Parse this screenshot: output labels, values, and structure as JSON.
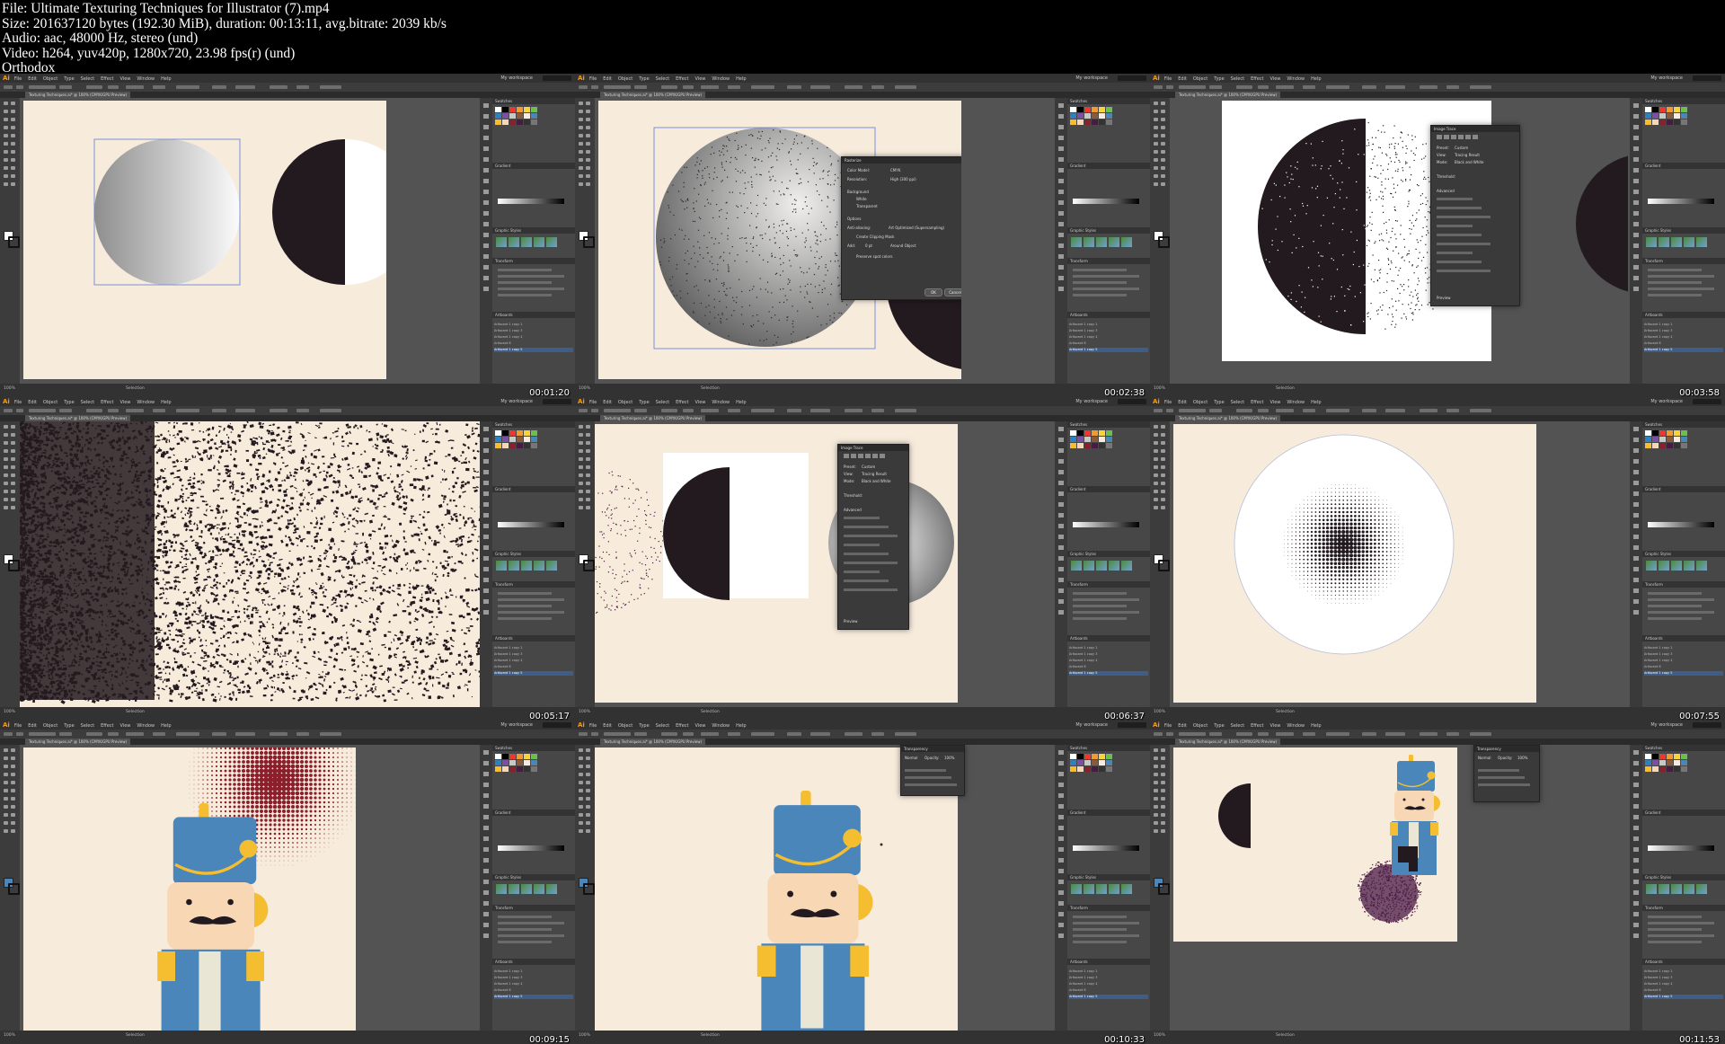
{
  "header": {
    "file": "File: Ultimate Texturing Techniques for Illustrator (7).mp4",
    "size": "Size: 201637120 bytes (192.30 MiB), duration: 00:13:11, avg.bitrate: 2039 kb/s",
    "audio": "Audio: aac, 48000 Hz, stereo (und)",
    "video": "Video: h264, yuv420p, 1280x720, 23.98 fps(r) (und)",
    "author": "Orthodox"
  },
  "app": {
    "logo": "Ai",
    "menu": [
      "File",
      "Edit",
      "Object",
      "Type",
      "Select",
      "Effect",
      "View",
      "Window",
      "Help"
    ],
    "workspace": "My workspace",
    "doc_tab": "Texturing Techniques.ai* @ 100% (CMYK/GPU Preview)",
    "zoom": "100%",
    "status": "Selection"
  },
  "panels": {
    "swatches": "Swatches",
    "gradient": "Gradient",
    "graphic_styles": "Graphic Styles",
    "transform": "Transform",
    "artboards": "Artboards",
    "artboard_rows": [
      "Artboard 1 copy 2",
      "Artboard 1 copy 3",
      "Artboard 1 copy 4",
      "Artboard 6",
      "Artboard 1 copy 5"
    ]
  },
  "rasterize_dialog": {
    "title": "Rasterize",
    "color_model_label": "Color Model:",
    "color_model": "CMYK",
    "resolution_label": "Resolution:",
    "resolution": "High (300 ppi)",
    "background": "Background",
    "white": "White",
    "transparent": "Transparent",
    "options": "Options",
    "anti_alias_label": "Anti-aliasing:",
    "anti_alias": "Art Optimized (Supersampling)",
    "clipping": "Create Clipping Mask",
    "add_label": "Add:",
    "add_value": "0 pt",
    "around": "Around Object",
    "spot": "Preserve spot colors",
    "ok": "OK",
    "cancel": "Cancel"
  },
  "image_trace_dialog": {
    "title": "Image Trace",
    "preset_label": "Preset:",
    "preset": "Custom",
    "view_label": "View:",
    "view": "Tracing Result",
    "mode_label": "Mode:",
    "mode": "Black and White",
    "threshold": "Threshold:",
    "advanced": "Advanced",
    "preview": "Preview"
  },
  "transparency_panel": {
    "title": "Transparency",
    "mode": "Normal",
    "opacity_label": "Opacity:",
    "opacity": "100%"
  },
  "timestamps": [
    "00:01:20",
    "00:02:38",
    "00:03:58",
    "00:05:17",
    "00:06:37",
    "00:07:55",
    "00:09:15",
    "00:10:33",
    "00:11:53"
  ],
  "colors": {
    "artboard_bg": "#f7ebdc",
    "dark": "#231a1f",
    "soldier_blue": "#4b86bb",
    "soldier_yellow": "#f5be30",
    "skin": "#f8d7b5",
    "red_halftone": "#8c1f2c",
    "plum": "#4a1a45"
  }
}
